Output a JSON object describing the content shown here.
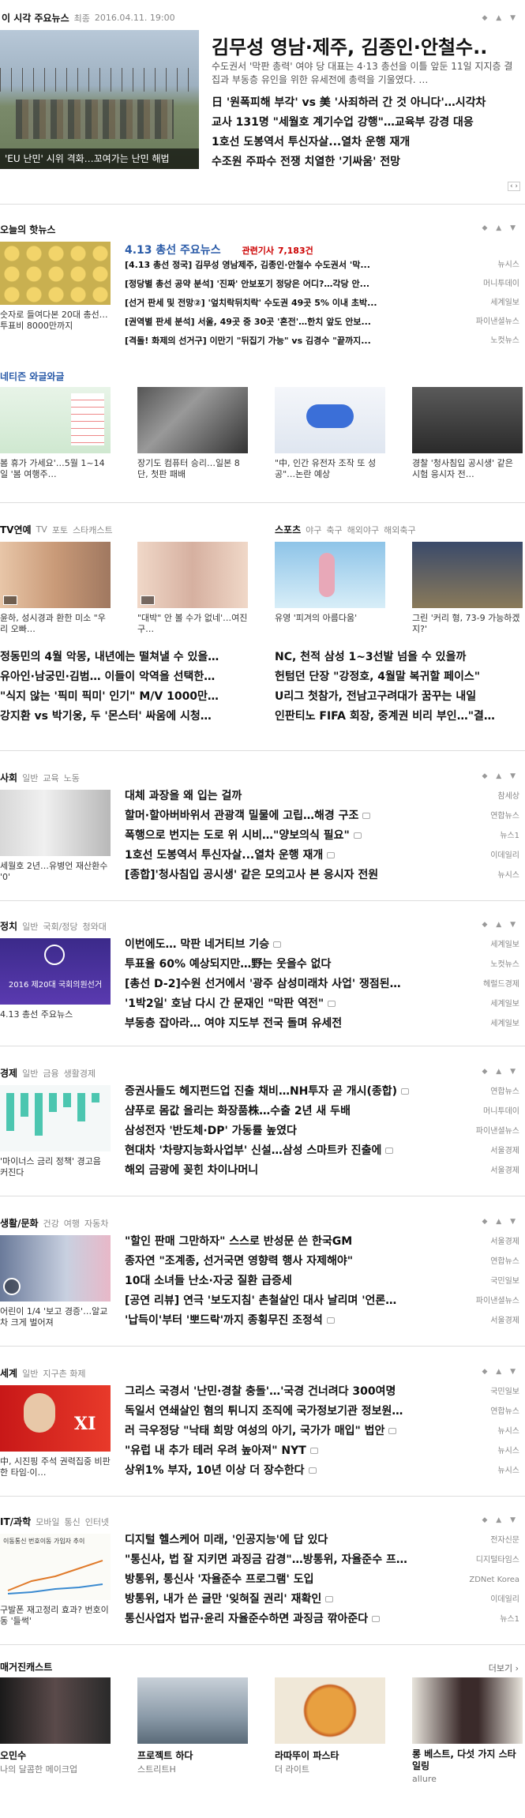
{
  "top": {
    "title": "이 시각 주요뉴스",
    "tab": "최종",
    "date": "2016.04.11. 19:00",
    "headline": "김무성 영남·제주, 김종인·안철수..",
    "summary": "수도권서 '막판 총력' 여야 당 대표는 4·13 총선을 이틀 앞둔 11일 지지층 결집과 부동층 유인을 위한 유세전에 총력을 기울였다. …",
    "photo_caption": "'EU 난민' 시위 격화…꼬여가는 난민 해법",
    "links": [
      "日 '원폭피해 부각' vs 美 '사죄하러 간 것 아니다'…시각차",
      "교사 131명 \"세월호 계기수업 강행\"…교육부 강경 대응",
      "1호선 도봉역서 투신자살...열차 운행 재개",
      "수조원 주파수 전쟁 치열한 '기싸움' 전망"
    ]
  },
  "today": {
    "title": "오늘의 핫뉴스",
    "photo_caption": "숫자로 들여다본 20대 총선…투표비 8000만까지",
    "topic": "4.13 총선 주요뉴스",
    "related": "관련기사",
    "related_count": "7,183건",
    "items": [
      {
        "t": "[4.13 총선 정국] 김무성 영남제주, 김종인·안철수 수도권서 '막...",
        "s": "뉴시스"
      },
      {
        "t": "[정당별 총선 공약 분석] '진짜' 안보포기 정당은 어디?…각당 안...",
        "s": "머니투데이"
      },
      {
        "t": "[선거 판세 및 전망②] '엎치락뒤치락' 수도권 49곳 5% 이내 초박...",
        "s": "세계일보"
      },
      {
        "t": "[권역별 판세 분석] 서울, 49곳 중 30곳 '혼전'…한치 앞도 안보...",
        "s": "파이낸셜뉴스"
      },
      {
        "t": "[격돌! 화제의 선거구] 이만기 \"뒤집기 가능\" vs 김경수 \"끝까지...",
        "s": "노컷뉴스"
      }
    ]
  },
  "net": {
    "title": "네티즌 와글와글",
    "items": [
      "봄 휴가 가세요'…5월 1~14일 '봄 여행주…",
      "장기도 컴퓨터 승리…일본 8단, 첫판 패배",
      "\"中, 인간 유전자 조작 또 성공\"…논란 예상",
      "경찰 '청사침입 공시생' 같은 시험 응시자 전…"
    ]
  },
  "tv": {
    "title": "TV연예",
    "tabs": [
      "TV",
      "포토",
      "스타캐스트"
    ],
    "caps": [
      "윤하, 성시경과 환한 미소 \"우리 오빠…",
      "\"대박\" 안 볼 수가 없네'…여진구…"
    ],
    "items": [
      "정동민의 4월 악몽, 내년에는 떨쳐낼 수 있을…",
      "유아인·남궁민·김범… 이들이 악역을 선택한…",
      "\"식지 않는 '픽미 픽미' 인기\" M/V 1000만…",
      "강지환 vs 박기웅, 두 '몬스터' 싸움에 시청…"
    ]
  },
  "sports": {
    "title": "스포츠",
    "tabs": [
      "야구",
      "축구",
      "해외야구",
      "해외축구"
    ],
    "caps": [
      "유영 '피겨의 아름다움'",
      "그린 '커리 형, 73-9 가능하겠지?'"
    ],
    "items": [
      "NC, 천적 삼성 1~3선발 넘을 수 있을까",
      "헌텀던 단장 \"강정호, 4월말 복귀할 페이스\"",
      "U리그 첫참가, 전남고구려대가 꿈꾸는 내일",
      "인판티노 FIFA 회장, 중계권 비리 부인…\"결…"
    ]
  },
  "society": {
    "title": "사회",
    "tabs": [
      "일반",
      "교육",
      "노동"
    ],
    "caption": "세월호 2년…유병언 재산환수 '0'",
    "items": [
      {
        "t": "대체 과장을 왜 입는 걸까",
        "s": "참세상"
      },
      {
        "t": "할머·할아버바위서 관광객 밀물에 고립…해경 구조",
        "s": "연합뉴스"
      },
      {
        "t": "폭행으로 번지는 도로 위 시비…\"양보의식 필요\"",
        "s": "뉴스1"
      },
      {
        "t": "1호선 도봉역서 투신자살...열차 운행 재개",
        "s": "이데일리"
      },
      {
        "t": "[종합]'청사침입 공시생' 같은 모의고사 본 응시자 전원",
        "s": "뉴시스"
      }
    ]
  },
  "politics": {
    "title": "정치",
    "tabs": [
      "일반",
      "국회/정당",
      "청와대"
    ],
    "caption": "4.13 총선 주요뉴스",
    "photo_text": "2016 제20대 국회의원선거",
    "items": [
      {
        "t": "이번에도… 막판 네거티브 기승",
        "s": "세계일보"
      },
      {
        "t": "투표율 60% 예상되지만…野는 웃을수 없다",
        "s": "노컷뉴스"
      },
      {
        "t": "[총선 D-2]수원 선거에서 '광주 삼성미래차 사업' 쟁점된…",
        "s": "헤럴드경제"
      },
      {
        "t": "'1박2일' 호남 다시 간 문재인 \"막판 역전\"",
        "s": "세계일보"
      },
      {
        "t": "부동층 잡아라… 여야 지도부 전국 돌며 유세전",
        "s": "세계일보"
      }
    ]
  },
  "economy": {
    "title": "경제",
    "tabs": [
      "일반",
      "금융",
      "생활경제"
    ],
    "caption": "'마이너스 금리 정책' 경고음 커진다",
    "bars": [
      -0.8,
      -0.5,
      -0.9,
      -0.4,
      -0.3,
      -0.6,
      -0.2
    ],
    "items": [
      {
        "t": "증권사들도 헤지펀드업 진출 채비…NH투자 곧 개시(종합)",
        "s": "연합뉴스"
      },
      {
        "t": "샴푸로 몸값 올리는 화장품株…수출 2년 새 두배",
        "s": "머니투데이"
      },
      {
        "t": "삼성전자 '반도체·DP' 가동률 높였다",
        "s": "파이낸셜뉴스"
      },
      {
        "t": "현대차 '차량지능화사업부' 신설…삼성 스마트카 진출에",
        "s": "서울경제"
      },
      {
        "t": "해외 금광에 꽂힌 차이나머니",
        "s": "서울경제"
      }
    ]
  },
  "life": {
    "title": "생활/문화",
    "tabs": [
      "건강",
      "여행",
      "자동차"
    ],
    "caption": "어린이 1/4 '보고 경증'…알교차 크게 벌어져",
    "items": [
      {
        "t": "\"할인 판매 그만하자\" 스스로 반성문 쓴 한국GM",
        "s": "서울경제"
      },
      {
        "t": "종자연 \"조계종, 선거국면 영향력 행사 자제해야\"",
        "s": "연합뉴스"
      },
      {
        "t": "10대 소녀들 난소·자궁 질환 급증세",
        "s": "국민일보"
      },
      {
        "t": "[공연 리뷰] 연극 '보도지침' 촌철살인 대사 날리며 '언론…",
        "s": "파이낸셜뉴스"
      },
      {
        "t": "'납득이'부터 '뽀드락'까지 종횡무진 조정석",
        "s": "서울경제"
      }
    ]
  },
  "world": {
    "title": "세계",
    "tabs": [
      "일반",
      "지구촌 화제"
    ],
    "caption": "中, 시진핑 주석 권력집중 비판한 타임·이…",
    "photo_text": "XI",
    "items": [
      {
        "t": "그리스 국경서 '난민·경찰 충돌'…'국경 건너려다 300여명",
        "s": "국민일보"
      },
      {
        "t": "독일서 연쇄살인 혐의 튀니지 조직에 국가정보기관 정보원…",
        "s": "연합뉴스"
      },
      {
        "t": "러 극우정당 \"낙태 희망 여성의 아기, 국가가 매입\" 법안",
        "s": "뉴시스"
      },
      {
        "t": "\"유럽 내 추가 테러 우려 높아져\" NYT",
        "s": "뉴시스"
      },
      {
        "t": "상위1% 부자, 10년 이상 더 장수한다",
        "s": "뉴시스"
      }
    ]
  },
  "it": {
    "title": "IT/과학",
    "tabs": [
      "모바일",
      "통신",
      "인터넷"
    ],
    "caption": "구발폰 재고정리 효과? 번호이동 '들썩'",
    "chart_text": "이동통신 번호이동 가입자 추이",
    "items": [
      {
        "t": "디지털 헬스케어 미래, '인공지능'에 답 있다",
        "s": "전자신문"
      },
      {
        "t": "\"통신사, 법 잘 지키면 과징금 감경\"…방통위, 자율준수 프…",
        "s": "디지털타임스"
      },
      {
        "t": "방통위, 통신사 '자율준수 프로그램' 도입",
        "s": "ZDNet Korea"
      },
      {
        "t": "방통위, 내가 쓴 글만 '잊혀질 권리' 재확인",
        "s": "이데일리"
      },
      {
        "t": "통신사업자 법규·윤리 자율준수하면 과징금 깎아준다",
        "s": "뉴스1"
      }
    ]
  },
  "magazine": {
    "title": "매거진캐스트",
    "more": "더보기",
    "items": [
      {
        "t": "오민수",
        "s": "나의 달콤한 메이크업"
      },
      {
        "t": "프로젝트 하다",
        "s": "스트리트H"
      },
      {
        "t": "라따뚜이 파스타",
        "s": "더 라이트"
      },
      {
        "t": "롱 베스트, 다섯 가지 스타일링",
        "s": "allure"
      }
    ]
  }
}
